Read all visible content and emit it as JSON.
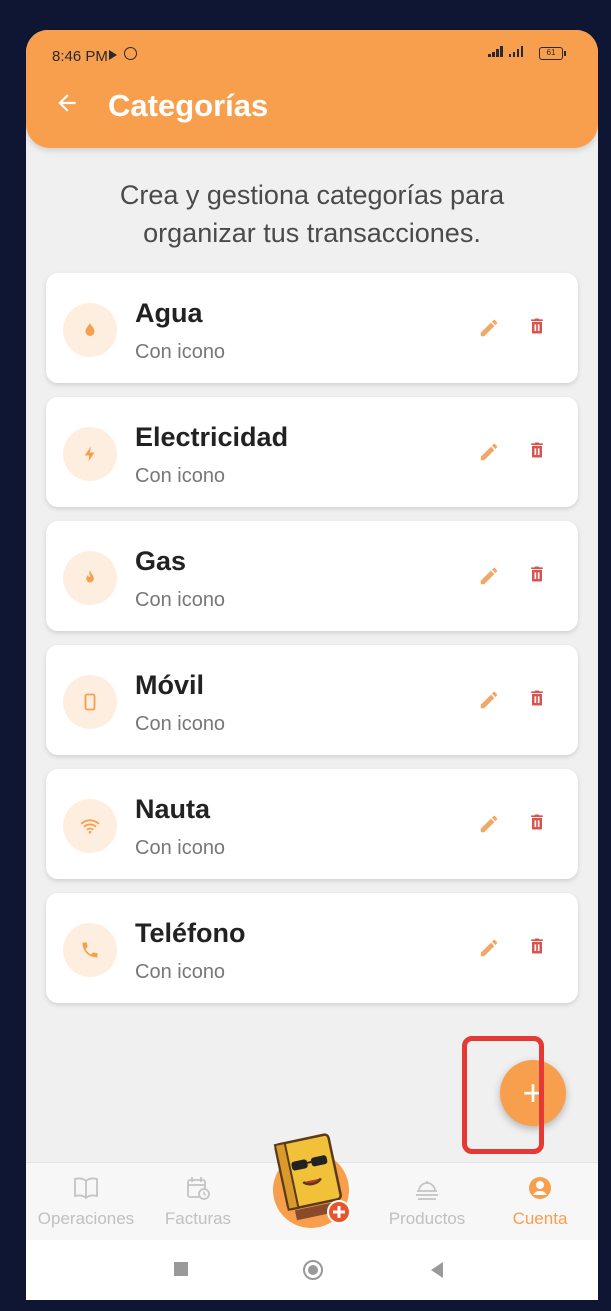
{
  "status_bar": {
    "time": "8:46 PM",
    "battery": "61"
  },
  "appbar": {
    "title": "Categorías",
    "back_icon": "arrow-left-icon"
  },
  "subtitle": "Crea y gestiona categorías para organizar tus transacciones.",
  "categories": [
    {
      "name": "Agua",
      "subtitle": "Con icono",
      "icon": "water-drop-icon"
    },
    {
      "name": "Electricidad",
      "subtitle": "Con icono",
      "icon": "lightning-bolt-icon"
    },
    {
      "name": "Gas",
      "subtitle": "Con icono",
      "icon": "flame-icon"
    },
    {
      "name": "Móvil",
      "subtitle": "Con icono",
      "icon": "smartphone-icon"
    },
    {
      "name": "Nauta",
      "subtitle": "Con icono",
      "icon": "wifi-icon"
    },
    {
      "name": "Teléfono",
      "subtitle": "Con icono",
      "icon": "phone-icon"
    }
  ],
  "fab": {
    "label": "+",
    "icon": "plus-icon"
  },
  "bottom_nav": [
    {
      "label": "Operaciones",
      "icon": "book-icon",
      "active": false
    },
    {
      "label": "Facturas",
      "icon": "calendar-clock-icon",
      "active": false
    },
    {
      "label": "Productos",
      "icon": "food-tray-icon",
      "active": false
    },
    {
      "label": "Cuenta",
      "icon": "account-icon",
      "active": true
    }
  ],
  "colors": {
    "accent": "#f79f4d",
    "icon_bg": "#fdeee0",
    "delete": "#d9534f",
    "background": "#f0f0f0",
    "highlight": "#e53935"
  }
}
